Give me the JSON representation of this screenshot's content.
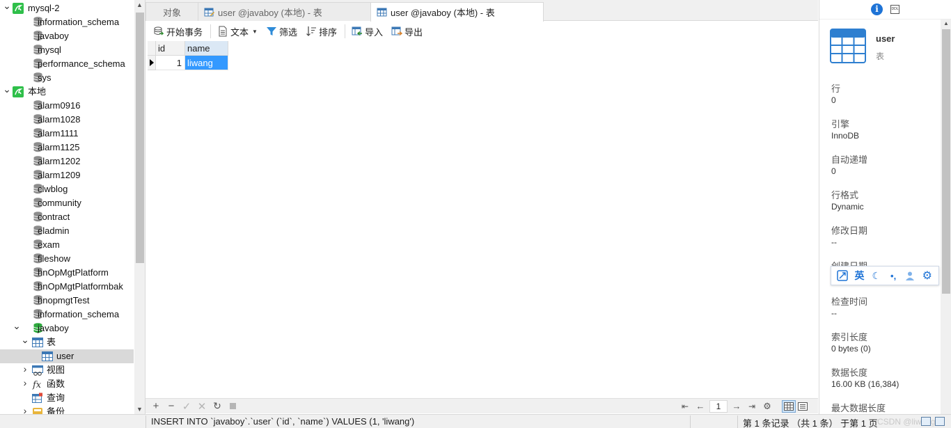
{
  "tree": {
    "items": [
      {
        "label": "mysql-2",
        "kind": "connection",
        "level": 0,
        "toggle": "expanded"
      },
      {
        "label": "information_schema",
        "kind": "db",
        "level": 1
      },
      {
        "label": "javaboy",
        "kind": "db",
        "level": 1
      },
      {
        "label": "mysql",
        "kind": "db",
        "level": 1
      },
      {
        "label": "performance_schema",
        "kind": "db",
        "level": 1
      },
      {
        "label": "sys",
        "kind": "db",
        "level": 1
      },
      {
        "label": "本地",
        "kind": "connection",
        "level": 0,
        "toggle": "expanded"
      },
      {
        "label": "alarm0916",
        "kind": "db",
        "level": 1
      },
      {
        "label": "alarm1028",
        "kind": "db",
        "level": 1
      },
      {
        "label": "alarm1111",
        "kind": "db",
        "level": 1
      },
      {
        "label": "alarm1125",
        "kind": "db",
        "level": 1
      },
      {
        "label": "alarm1202",
        "kind": "db",
        "level": 1
      },
      {
        "label": "alarm1209",
        "kind": "db",
        "level": 1
      },
      {
        "label": "clwblog",
        "kind": "db",
        "level": 1
      },
      {
        "label": "community",
        "kind": "db",
        "level": 1
      },
      {
        "label": "contract",
        "kind": "db",
        "level": 1
      },
      {
        "label": "eladmin",
        "kind": "db",
        "level": 1
      },
      {
        "label": "exam",
        "kind": "db",
        "level": 1
      },
      {
        "label": "fileshow",
        "kind": "db",
        "level": 1
      },
      {
        "label": "hnOpMgtPlatform",
        "kind": "db",
        "level": 1
      },
      {
        "label": "hnOpMgtPlatformbak",
        "kind": "db",
        "level": 1
      },
      {
        "label": "hnopmgtTest",
        "kind": "db",
        "level": 1
      },
      {
        "label": "information_schema",
        "kind": "db",
        "level": 1
      },
      {
        "label": "javaboy",
        "kind": "db-open",
        "level": 1,
        "toggle": "expanded"
      },
      {
        "label": "表",
        "kind": "tables",
        "level": 2,
        "toggle": "expanded"
      },
      {
        "label": "user",
        "kind": "table",
        "level": 3,
        "selected": true
      },
      {
        "label": "视图",
        "kind": "views",
        "level": 2,
        "toggle": "collapsed"
      },
      {
        "label": "函数",
        "kind": "functions",
        "level": 2,
        "toggle": "collapsed"
      },
      {
        "label": "查询",
        "kind": "queries",
        "level": 2
      },
      {
        "label": "备份",
        "kind": "backups",
        "level": 2,
        "toggle": "collapsed"
      }
    ]
  },
  "tabs": [
    {
      "label": "对象",
      "icon": "none",
      "active": false
    },
    {
      "label": "user @javaboy (本地) - 表",
      "icon": "table-design-icon",
      "active": false
    },
    {
      "label": "user @javaboy (本地) - 表",
      "icon": "table-icon",
      "active": true
    }
  ],
  "toolbar": {
    "begin_transaction": "开始事务",
    "text": "文本",
    "filter": "筛选",
    "sort": "排序",
    "import": "导入",
    "export": "导出"
  },
  "grid": {
    "columns": [
      "id",
      "name"
    ],
    "rows": [
      {
        "id": "1",
        "name": "liwang"
      }
    ]
  },
  "pager": {
    "page": "1"
  },
  "status": {
    "sql": "INSERT INTO `javaboy`.`user` (`id`, `name`) VALUES (1, 'liwang')",
    "records": "第 1 条记录 （共 1 条） 于第 1 页",
    "watermark": "CSDN @liwangC"
  },
  "info": {
    "object_name": "user",
    "object_type": "表",
    "ddl_badge": "DDL",
    "properties": [
      {
        "label": "行",
        "value": "0"
      },
      {
        "label": "引擎",
        "value": "InnoDB"
      },
      {
        "label": "自动递增",
        "value": "0"
      },
      {
        "label": "行格式",
        "value": "Dynamic"
      },
      {
        "label": "修改日期",
        "value": "--"
      },
      {
        "label": "创建日期",
        "value": ""
      },
      {
        "label": "检查时间",
        "value": "--"
      },
      {
        "label": "索引长度",
        "value": "0 bytes (0)"
      },
      {
        "label": "数据长度",
        "value": "16.00 KB (16,384)"
      },
      {
        "label": "最大数据长度",
        "value": ""
      }
    ]
  },
  "ime": {
    "lang": "英"
  },
  "colors": {
    "accent": "#1e73d6",
    "selection": "#3399ff",
    "navicat_green": "#2fbf4a"
  }
}
